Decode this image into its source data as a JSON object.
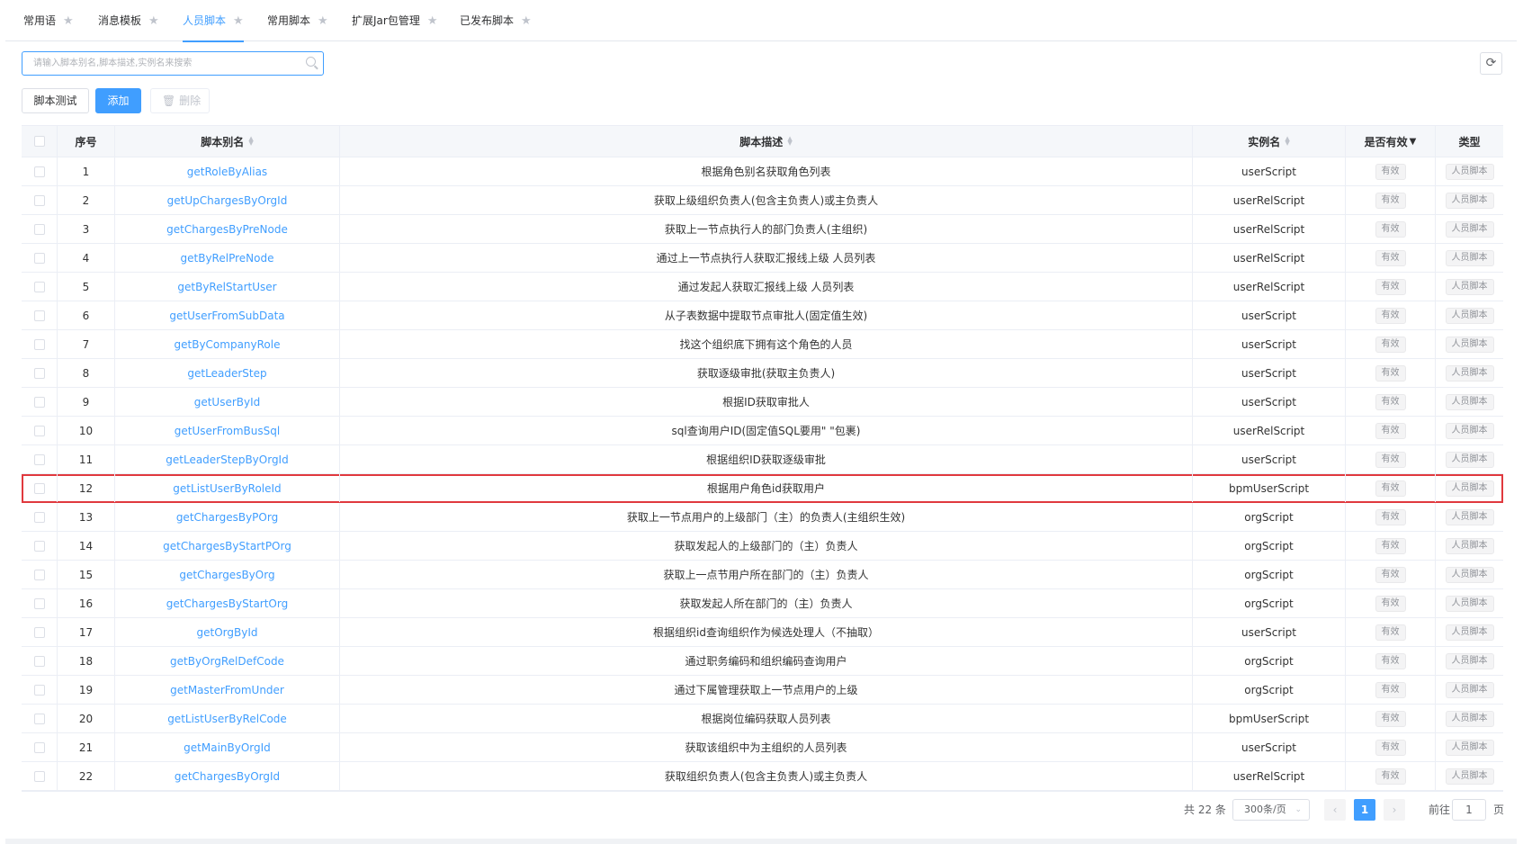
{
  "tabs": [
    {
      "label": "常用语",
      "active": false
    },
    {
      "label": "消息模板",
      "active": false
    },
    {
      "label": "人员脚本",
      "active": true
    },
    {
      "label": "常用脚本",
      "active": false
    },
    {
      "label": "扩展Jar包管理",
      "active": false
    },
    {
      "label": "已发布脚本",
      "active": false
    }
  ],
  "search": {
    "placeholder": "请输入脚本别名,脚本描述,实例名来搜索"
  },
  "toolbar": {
    "test_label": "脚本测试",
    "add_label": "添加",
    "delete_label": "删除"
  },
  "table": {
    "headers": {
      "index": "序号",
      "alias": "脚本别名",
      "desc": "脚本描述",
      "instance": "实例名",
      "valid": "是否有效",
      "type": "类型"
    },
    "rows": [
      {
        "idx": "1",
        "alias": "getRoleByAlias",
        "desc": "根据角色别名获取角色列表",
        "instance": "userScript",
        "valid": "有效",
        "type": "人员脚本"
      },
      {
        "idx": "2",
        "alias": "getUpChargesByOrgId",
        "desc": "获取上级组织负责人(包含主负责人)或主负责人",
        "instance": "userRelScript",
        "valid": "有效",
        "type": "人员脚本"
      },
      {
        "idx": "3",
        "alias": "getChargesByPreNode",
        "desc": "获取上一节点执行人的部门负责人(主组织)",
        "instance": "userRelScript",
        "valid": "有效",
        "type": "人员脚本"
      },
      {
        "idx": "4",
        "alias": "getByRelPreNode",
        "desc": "通过上一节点执行人获取汇报线上级 人员列表",
        "instance": "userRelScript",
        "valid": "有效",
        "type": "人员脚本"
      },
      {
        "idx": "5",
        "alias": "getByRelStartUser",
        "desc": "通过发起人获取汇报线上级 人员列表",
        "instance": "userRelScript",
        "valid": "有效",
        "type": "人员脚本"
      },
      {
        "idx": "6",
        "alias": "getUserFromSubData",
        "desc": "从子表数据中提取节点审批人(固定值生效)",
        "instance": "userScript",
        "valid": "有效",
        "type": "人员脚本"
      },
      {
        "idx": "7",
        "alias": "getByCompanyRole",
        "desc": "找这个组织底下拥有这个角色的人员",
        "instance": "userScript",
        "valid": "有效",
        "type": "人员脚本"
      },
      {
        "idx": "8",
        "alias": "getLeaderStep",
        "desc": "获取逐级审批(获取主负责人)",
        "instance": "userScript",
        "valid": "有效",
        "type": "人员脚本"
      },
      {
        "idx": "9",
        "alias": "getUserById",
        "desc": "根据ID获取审批人",
        "instance": "userScript",
        "valid": "有效",
        "type": "人员脚本"
      },
      {
        "idx": "10",
        "alias": "getUserFromBusSql",
        "desc": "sql查询用户ID(固定值SQL要用\" \"包裹)",
        "instance": "userRelScript",
        "valid": "有效",
        "type": "人员脚本"
      },
      {
        "idx": "11",
        "alias": "getLeaderStepByOrgId",
        "desc": "根据组织ID获取逐级审批",
        "instance": "userScript",
        "valid": "有效",
        "type": "人员脚本"
      },
      {
        "idx": "12",
        "alias": "getListUserByRoleId",
        "desc": "根据用户角色id获取用户",
        "instance": "bpmUserScript",
        "valid": "有效",
        "type": "人员脚本",
        "selected": true
      },
      {
        "idx": "13",
        "alias": "getChargesByPOrg",
        "desc": "获取上一节点用户的上级部门（主）的负责人(主组织生效)",
        "instance": "orgScript",
        "valid": "有效",
        "type": "人员脚本"
      },
      {
        "idx": "14",
        "alias": "getChargesByStartPOrg",
        "desc": "获取发起人的上级部门的（主）负责人",
        "instance": "orgScript",
        "valid": "有效",
        "type": "人员脚本"
      },
      {
        "idx": "15",
        "alias": "getChargesByOrg",
        "desc": "获取上一点节用户所在部门的（主）负责人",
        "instance": "orgScript",
        "valid": "有效",
        "type": "人员脚本"
      },
      {
        "idx": "16",
        "alias": "getChargesByStartOrg",
        "desc": "获取发起人所在部门的（主）负责人",
        "instance": "orgScript",
        "valid": "有效",
        "type": "人员脚本"
      },
      {
        "idx": "17",
        "alias": "getOrgById",
        "desc": "根据组织id查询组织作为候选处理人（不抽取）",
        "instance": "userScript",
        "valid": "有效",
        "type": "人员脚本"
      },
      {
        "idx": "18",
        "alias": "getByOrgRelDefCode",
        "desc": "通过职务编码和组织编码查询用户",
        "instance": "orgScript",
        "valid": "有效",
        "type": "人员脚本"
      },
      {
        "idx": "19",
        "alias": "getMasterFromUnder",
        "desc": "通过下属管理获取上一节点用户的上级",
        "instance": "orgScript",
        "valid": "有效",
        "type": "人员脚本"
      },
      {
        "idx": "20",
        "alias": "getListUserByRelCode",
        "desc": "根据岗位编码获取人员列表",
        "instance": "bpmUserScript",
        "valid": "有效",
        "type": "人员脚本"
      },
      {
        "idx": "21",
        "alias": "getMainByOrgId",
        "desc": "获取该组织中为主组织的人员列表",
        "instance": "userScript",
        "valid": "有效",
        "type": "人员脚本"
      },
      {
        "idx": "22",
        "alias": "getChargesByOrgId",
        "desc": "获取组织负责人(包含主负责人)或主负责人",
        "instance": "userRelScript",
        "valid": "有效",
        "type": "人员脚本"
      }
    ]
  },
  "pagination": {
    "total_text": "共 22 条",
    "page_size": "300条/页",
    "prev": "‹",
    "current_page": "1",
    "next": "›",
    "goto_label": "前往",
    "goto_value": "1",
    "page_suffix": "页"
  }
}
